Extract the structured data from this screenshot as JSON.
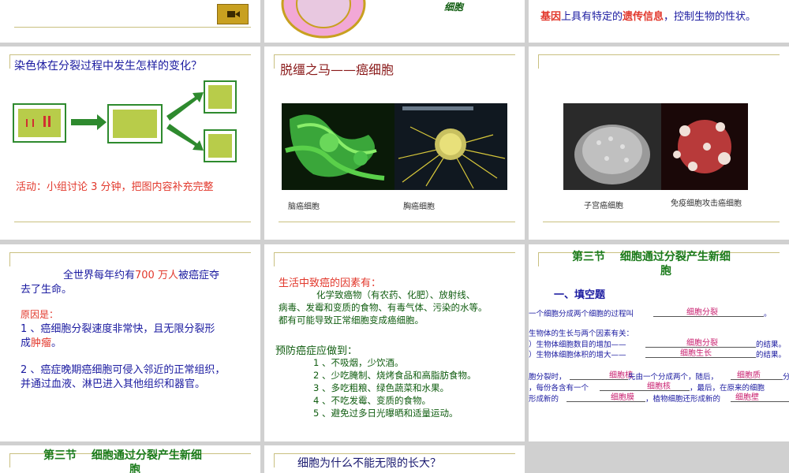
{
  "s1": {},
  "s2": {
    "cell_label": "细胞"
  },
  "s3": {
    "gene": "基因",
    "t1": "上具有特定的",
    "info": "遗传信息",
    "t2": "，控制生物的性状。"
  },
  "s4": {
    "title": "染色体在分裂过程中发生怎样的变化？",
    "activity": "活动：小组讨论 3 分钟，把图内容补充完整"
  },
  "s5": {
    "title": "脱缰之马——癌细胞",
    "cap1": "脑癌细胞",
    "cap2": "胸癌细胞"
  },
  "s6": {
    "cap1": "子宫癌细胞",
    "cap2": "免疫细胞攻击癌细胞"
  },
  "s7": {
    "p1a": "全世界每年约有",
    "p1num": "700 万人",
    "p1b": "被癌症夺",
    "p1c": "去了生命。",
    "reason": "原因是：",
    "r1a": "1 、癌细胞分裂速度非常快，且无限分裂形",
    "r1b": "成",
    "r1c": "肿瘤",
    "r1d": "。",
    "r2a": "2 、癌症晚期癌细胞可侵入邻近的正常组织，",
    "r2b": "并通过血液、淋巴进入其他组织和器官。"
  },
  "s8": {
    "factors": "生活中致癌的因素有：",
    "f1": "化学致癌物（有农药、化肥）、放射线、",
    "f2": "病毒、发霉和变质的食物、有毒气体、污染的水等。",
    "f3": "都有可能导致正常细胞变成癌细胞。",
    "prevent": "预防癌症应做到：",
    "items": [
      "1 、不吸烟，少饮酒。",
      "2 、少吃腌制、烧烤食品和高脂肪食物。",
      "3 、多吃粗粮、绿色蔬菜和水果。",
      "4 、不吃发霉、变质的食物。",
      "5 、避免过多日光曝晒和适量运动。"
    ]
  },
  "s9": {
    "title1": "第三节　  细胞通过分裂产生新细",
    "title2": "胞",
    "section": "一、填空题",
    "l1": "一个细胞分成两个细胞的过程叫",
    "a1": "细胞分裂",
    "l1end": "。",
    "l2": "生物体的生长与两个因素有关：",
    "l3": "）生物体细胞数目的增加——",
    "a3": "细胞分裂",
    "l3end": "的结果。",
    "l4": "）生物体细胞体积的增大——",
    "a4": "细胞生长",
    "l4end": "的结果。",
    "l5a": "胞分裂时，",
    "a5a": "细胞核",
    "l5b": "先由一个分成两个，随后，",
    "a5b": "细胞质",
    "l5c": "分",
    "l6a": "，每份各含有一个",
    "a6": "细胞核",
    "l6b": "，最后，在原来的细胞",
    "l7a": "形成新的",
    "a7a": "细胞膜",
    "l7b": "，植物细胞还形成新的",
    "a7b": "细胞壁"
  },
  "s10": {
    "title1": "第三节　  细胞通过分裂产生新细",
    "title2": "胞"
  },
  "s11": {
    "title": "细胞为什么不能无限的长大？"
  }
}
